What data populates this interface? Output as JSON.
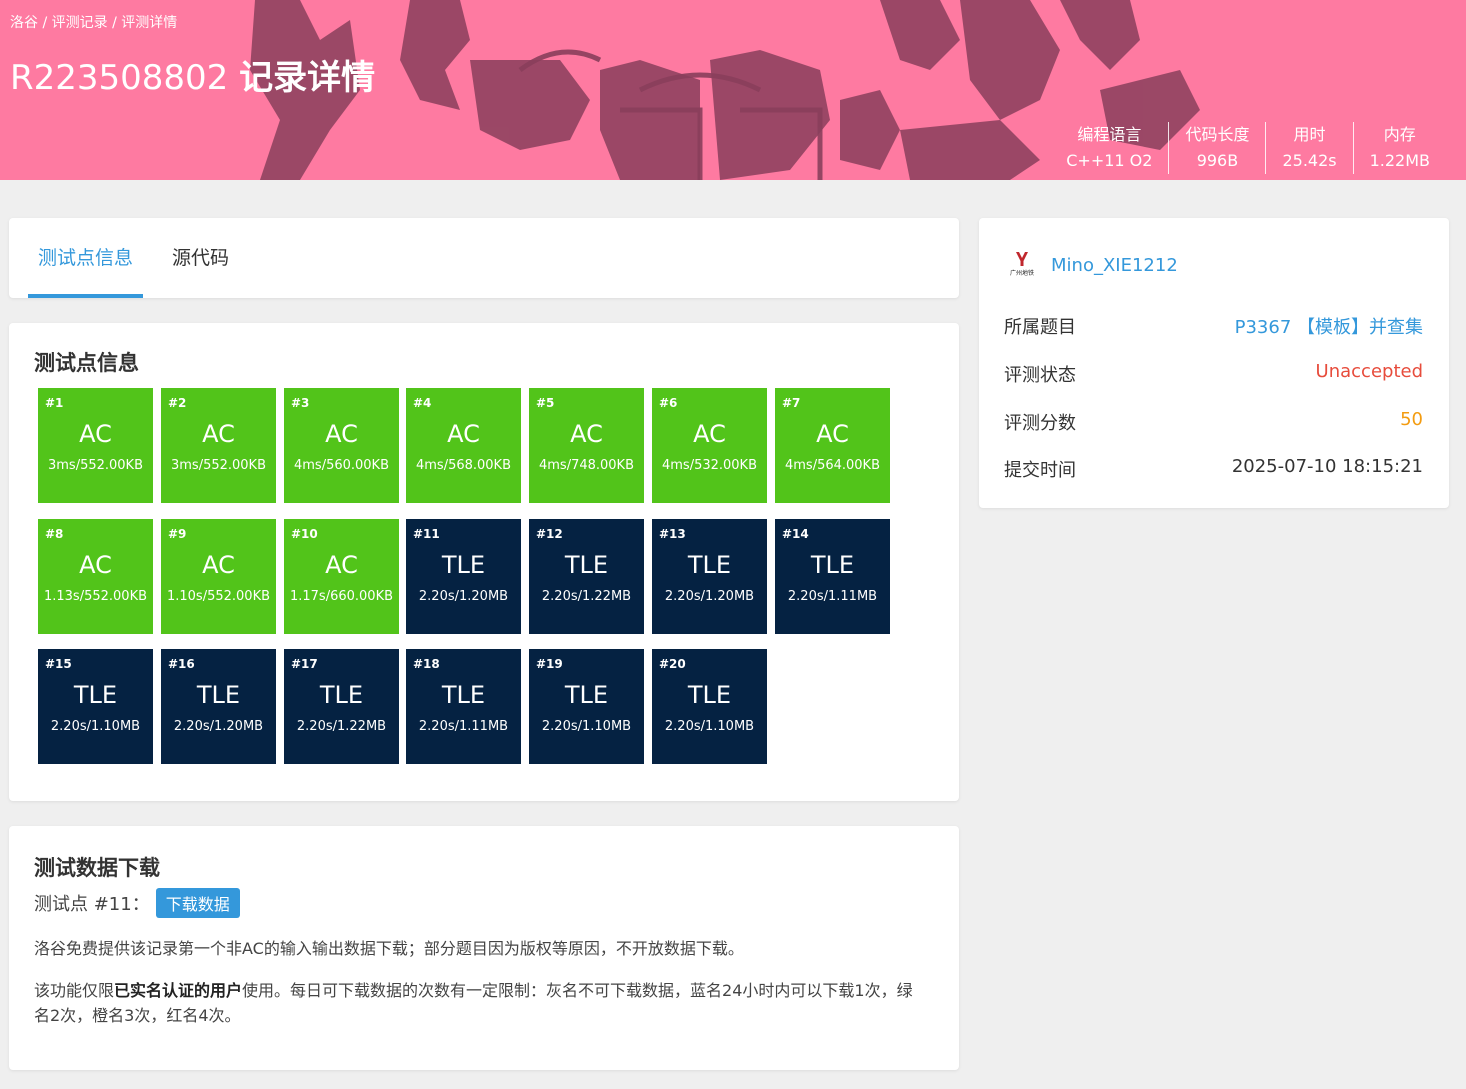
{
  "breadcrumb": {
    "home": "洛谷",
    "sep1": " / ",
    "records": "评测记录",
    "sep2": " / ",
    "current": "评测详情"
  },
  "header": {
    "record_id": "R223508802",
    "title_suffix": "记录详情"
  },
  "stats": [
    {
      "label": "编程语言",
      "value": "C++11 O2"
    },
    {
      "label": "代码长度",
      "value": "996B"
    },
    {
      "label": "用时",
      "value": "25.42s"
    },
    {
      "label": "内存",
      "value": "1.22MB"
    }
  ],
  "tabs": [
    {
      "label": "测试点信息",
      "active": true
    },
    {
      "label": "源代码",
      "active": false
    }
  ],
  "testcases_section": {
    "title": "测试点信息",
    "cases": [
      {
        "num": "#1",
        "status": "AC",
        "info": "3ms/552.00KB"
      },
      {
        "num": "#2",
        "status": "AC",
        "info": "3ms/552.00KB"
      },
      {
        "num": "#3",
        "status": "AC",
        "info": "4ms/560.00KB"
      },
      {
        "num": "#4",
        "status": "AC",
        "info": "4ms/568.00KB"
      },
      {
        "num": "#5",
        "status": "AC",
        "info": "4ms/748.00KB"
      },
      {
        "num": "#6",
        "status": "AC",
        "info": "4ms/532.00KB"
      },
      {
        "num": "#7",
        "status": "AC",
        "info": "4ms/564.00KB"
      },
      {
        "num": "#8",
        "status": "AC",
        "info": "1.13s/552.00KB"
      },
      {
        "num": "#9",
        "status": "AC",
        "info": "1.10s/552.00KB"
      },
      {
        "num": "#10",
        "status": "AC",
        "info": "1.17s/660.00KB"
      },
      {
        "num": "#11",
        "status": "TLE",
        "info": "2.20s/1.20MB"
      },
      {
        "num": "#12",
        "status": "TLE",
        "info": "2.20s/1.22MB"
      },
      {
        "num": "#13",
        "status": "TLE",
        "info": "2.20s/1.20MB"
      },
      {
        "num": "#14",
        "status": "TLE",
        "info": "2.20s/1.11MB"
      },
      {
        "num": "#15",
        "status": "TLE",
        "info": "2.20s/1.10MB"
      },
      {
        "num": "#16",
        "status": "TLE",
        "info": "2.20s/1.20MB"
      },
      {
        "num": "#17",
        "status": "TLE",
        "info": "2.20s/1.22MB"
      },
      {
        "num": "#18",
        "status": "TLE",
        "info": "2.20s/1.11MB"
      },
      {
        "num": "#19",
        "status": "TLE",
        "info": "2.20s/1.10MB"
      },
      {
        "num": "#20",
        "status": "TLE",
        "info": "2.20s/1.10MB"
      }
    ]
  },
  "download_section": {
    "title": "测试数据下载",
    "line_label": "测试点 #11：",
    "button_label": "下载数据",
    "para1": "洛谷免费提供该记录第一个非AC的输入输出数据下载；部分题目因为版权等原因，不开放数据下载。",
    "para2_pre": "该功能仅限",
    "para2_bold": "已实名认证的用户",
    "para2_post": "使用。每日可下载数据的次数有一定限制：灰名不可下载数据，蓝名24小时内可以下载1次，绿名2次，橙名3次，红名4次。"
  },
  "sidebar": {
    "avatar_text": "广州地铁",
    "username": "Mino_XIE1212",
    "problem_label": "所属题目",
    "problem_value": "P3367 【模板】并查集",
    "status_label": "评测状态",
    "status_value": "Unaccepted",
    "score_label": "评测分数",
    "score_value": "50",
    "time_label": "提交时间",
    "time_value": "2025-07-10 18:15:21"
  },
  "colors": {
    "banner": "#fe7aa1",
    "banner_art": "#8a3f5c",
    "accent": "#3498db",
    "ac": "#52c41a",
    "tle": "#052242",
    "unaccepted": "#e74c3c",
    "score": "#f39c11"
  }
}
